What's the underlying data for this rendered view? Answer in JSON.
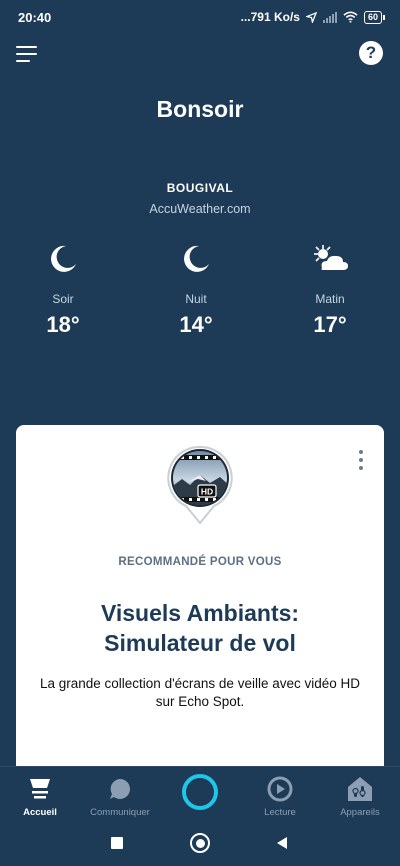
{
  "status_bar": {
    "time": "20:40",
    "network_speed": "...791 Ko/s",
    "battery": "60"
  },
  "header": {
    "menu_icon": "hamburger-menu-icon",
    "help_label": "?"
  },
  "greeting": "Bonsoir",
  "weather": {
    "location": "BOUGIVAL",
    "provider": "AccuWeather.com",
    "forecast": [
      {
        "label": "Soir",
        "temp": "18°",
        "icon": "moon-icon"
      },
      {
        "label": "Nuit",
        "temp": "14°",
        "icon": "moon-icon"
      },
      {
        "label": "Matin",
        "temp": "17°",
        "icon": "sun-cloud-icon"
      }
    ]
  },
  "card": {
    "overline": "RECOMMANDÉ POUR VOUS",
    "title_line1": "Visuels Ambiants:",
    "title_line2": "Simulateur de vol",
    "description": "La grande collection d'écrans de veille avec vidéo HD sur Echo Spot.",
    "logo_badge": "HD"
  },
  "bottom_nav": {
    "items": [
      {
        "label": "Accueil",
        "icon": "home-icon",
        "active": true
      },
      {
        "label": "Communiquer",
        "icon": "chat-bubble-icon",
        "active": false
      },
      {
        "label": "",
        "icon": "alexa-icon",
        "active": false
      },
      {
        "label": "Lecture",
        "icon": "play-icon",
        "active": false
      },
      {
        "label": "Appareils",
        "icon": "devices-icon",
        "active": false
      }
    ]
  },
  "colors": {
    "background": "#1d3b57",
    "alexa_accent": "#1ec7ea",
    "card_background": "#ffffff"
  }
}
